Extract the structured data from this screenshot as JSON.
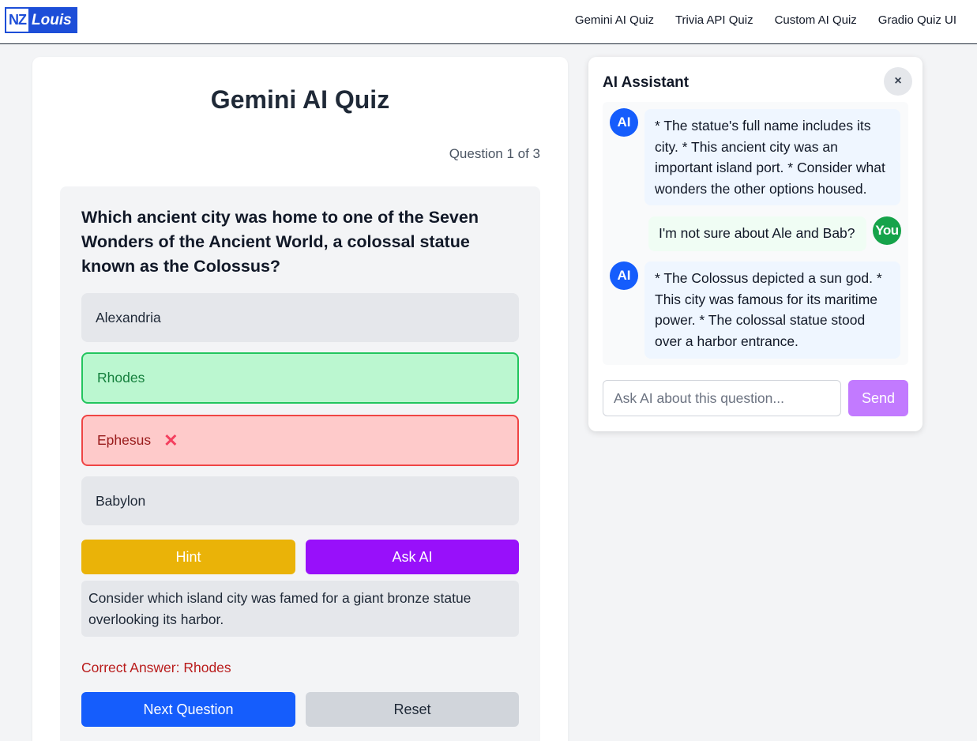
{
  "header": {
    "logo_prefix": "NZ",
    "logo_name": "Louis",
    "nav": [
      {
        "label": "Gemini AI Quiz"
      },
      {
        "label": "Trivia API Quiz"
      },
      {
        "label": "Custom AI Quiz"
      },
      {
        "label": "Gradio Quiz UI"
      }
    ]
  },
  "quiz": {
    "title": "Gemini AI Quiz",
    "progress": "Question 1 of 3",
    "question": "Which ancient city was home to one of the Seven Wonders of the Ancient World, a colossal statue known as the Colossus?",
    "options": [
      {
        "label": "Alexandria",
        "state": "neutral"
      },
      {
        "label": "Rhodes",
        "state": "correct"
      },
      {
        "label": "Ephesus",
        "state": "wrong"
      },
      {
        "label": "Babylon",
        "state": "neutral"
      }
    ],
    "wrong_mark": "✕",
    "hint_label": "Hint",
    "ask_ai_label": "Ask AI",
    "hint_text": "Consider which island city was famed for a giant bronze statue overlooking its harbor.",
    "correct_answer": "Correct Answer: Rhodes",
    "next_label": "Next Question",
    "reset_label": "Reset"
  },
  "assistant": {
    "title": "AI Assistant",
    "close_label": "×",
    "messages": [
      {
        "sender": "AI",
        "text": "* The statue's full name includes its city. * This ancient city was an important island port. * Consider what wonders the other options housed."
      },
      {
        "sender": "You",
        "text": "I'm not sure about Ale and Bab?"
      },
      {
        "sender": "AI",
        "text": "* The Colossus depicted a sun god. * This city was famous for its maritime power. * The colossal statue stood over a harbor entrance."
      }
    ],
    "input_placeholder": "Ask AI about this question...",
    "send_label": "Send"
  },
  "colors": {
    "primary": "#155dfc",
    "hint": "#eab308",
    "ask_ai": "#9810fa",
    "correct_bg": "#bbf7d0",
    "wrong_bg": "#fecaca",
    "send": "#c27aff",
    "user_avatar": "#16a34a"
  }
}
